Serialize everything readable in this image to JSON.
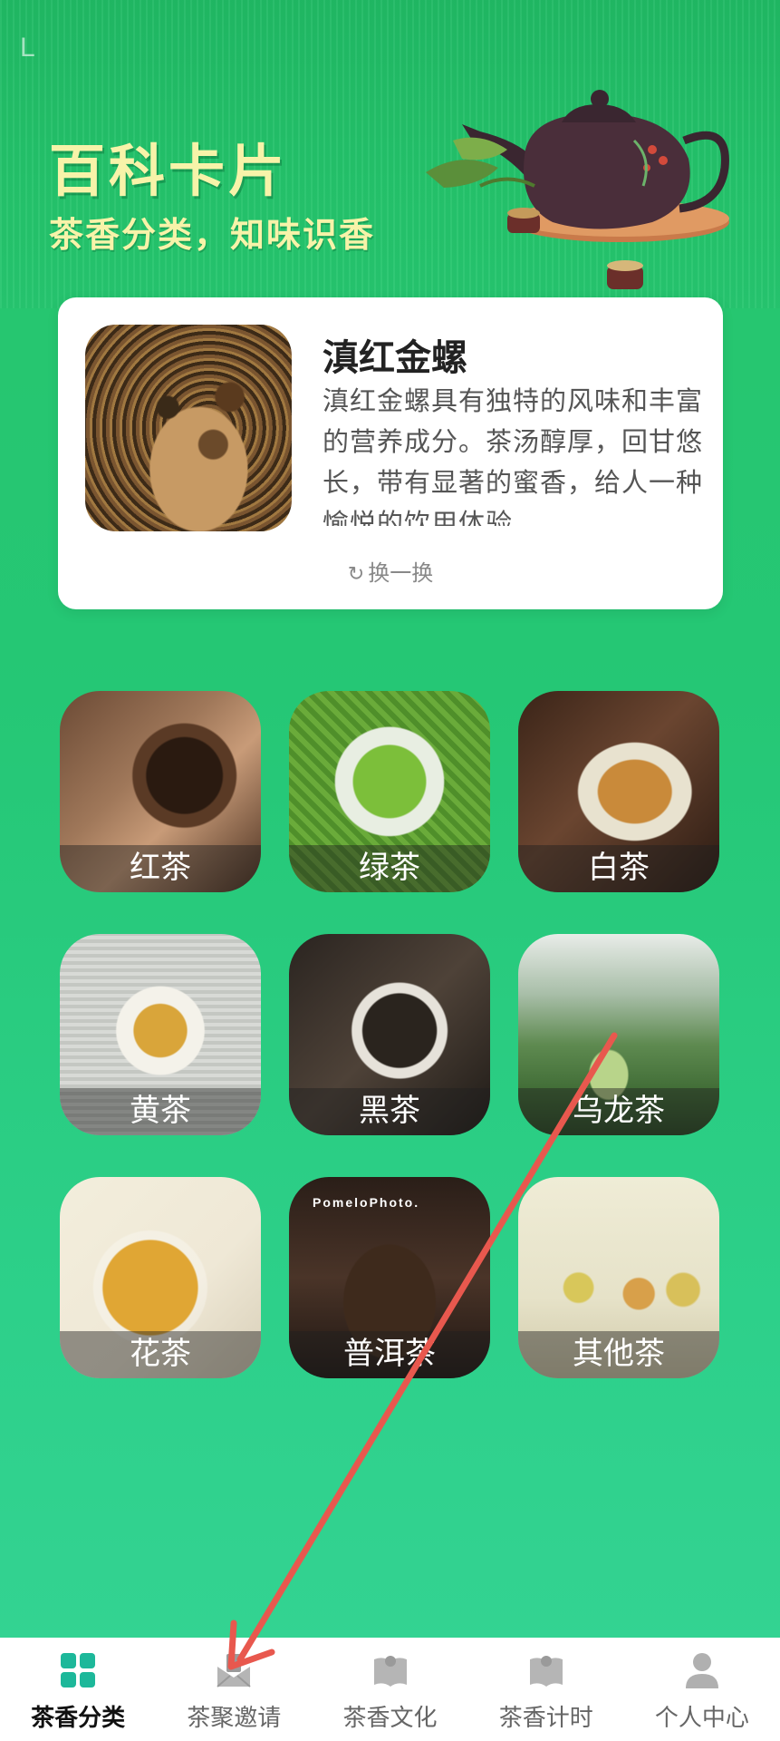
{
  "status": {
    "left_glyph": "L"
  },
  "header": {
    "title": "百科卡片",
    "subtitle": "茶香分类，知味识香"
  },
  "card": {
    "title": "滇红金螺",
    "description": "滇红金螺具有独特的风味和丰富的营养成分。茶汤醇厚，回甘悠长，带有显著的蜜香，给人一种愉悦的饮用体验。",
    "refresh_icon": "refresh-icon",
    "refresh_label": "换一换"
  },
  "categories": [
    {
      "label": "红茶"
    },
    {
      "label": "绿茶"
    },
    {
      "label": "白茶"
    },
    {
      "label": "黄茶"
    },
    {
      "label": "黑茶"
    },
    {
      "label": "乌龙茶"
    },
    {
      "label": "花茶"
    },
    {
      "label": "普洱茶"
    },
    {
      "label": "其他茶"
    }
  ],
  "watermark": {
    "text": "PomeloPhoto."
  },
  "bottom_nav": [
    {
      "label": "茶香分类",
      "icon": "grid-icon",
      "active": true
    },
    {
      "label": "茶聚邀请",
      "icon": "envelope-icon",
      "active": false
    },
    {
      "label": "茶香文化",
      "icon": "book-icon",
      "active": false
    },
    {
      "label": "茶香计时",
      "icon": "book-timer-icon",
      "active": false
    },
    {
      "label": "个人中心",
      "icon": "person-icon",
      "active": false
    }
  ],
  "colors": {
    "accent": "#1DB89A",
    "hero_text": "#F7F3A9",
    "annotation_arrow": "#E8584E"
  }
}
